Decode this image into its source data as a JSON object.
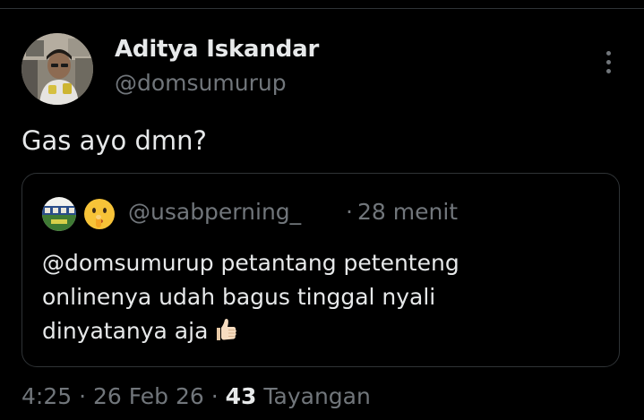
{
  "tweet": {
    "author_name": "Aditya Iskandar",
    "author_handle": "@domsumurup",
    "text": "Gas ayo dmn?",
    "time": "4:25",
    "separator": "·",
    "date": "26 Feb 26",
    "views_count": "43",
    "views_label": "Tayangan"
  },
  "quote": {
    "handle": "@usabperning_",
    "separator": "·",
    "time": "28 menit",
    "lines": [
      "@domsumurup petantang petenteng",
      "onlinenya udah bagus tinggal nyali",
      "dinyatanya aja"
    ],
    "emoji_icon": "shushing-face-emoji",
    "trailing_icon": "thumbs-up-emoji"
  },
  "icons": {
    "more": "more-vertical-icon"
  },
  "colors": {
    "background": "#000000",
    "primary_text": "#e7e9ea",
    "secondary_text": "#71767b",
    "border": "#2f3336"
  }
}
